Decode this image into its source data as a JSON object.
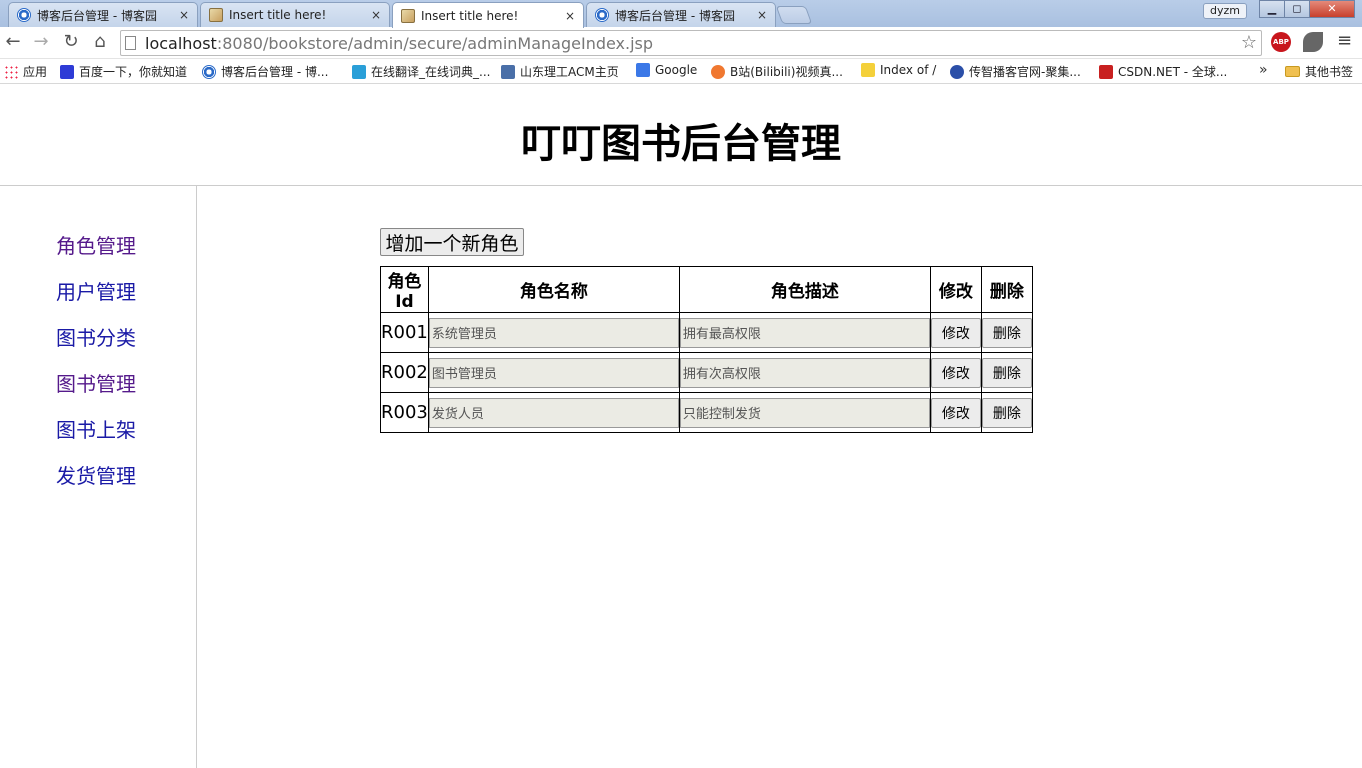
{
  "browser": {
    "tabs": [
      {
        "title": "博客后台管理 - 博客园",
        "icon": "cnblogs-icon",
        "active": false
      },
      {
        "title": "Insert title here!",
        "icon": "image-icon",
        "active": false
      },
      {
        "title": "Insert title here!",
        "icon": "image-icon",
        "active": true
      },
      {
        "title": "博客后台管理 - 博客园",
        "icon": "cnblogs-icon",
        "active": false
      }
    ],
    "tab_close_glyph": "×",
    "user_name": "dyzm",
    "url_host": "localhost",
    "url_rest": ":8080/bookstore/admin/secure/adminManageIndex.jsp",
    "abp_label": "ABP",
    "bookmarks": [
      {
        "label": "应用",
        "icon": "apps-icon"
      },
      {
        "label": "百度一下，你就知道",
        "icon": "baidu-icon"
      },
      {
        "label": "博客后台管理 - 博...",
        "icon": "cnblogs-icon"
      },
      {
        "label": "在线翻译_在线词典_...",
        "icon": "dict-icon"
      },
      {
        "label": "山东理工ACM主页",
        "icon": "acm-icon"
      },
      {
        "label": "Google",
        "icon": "google-icon"
      },
      {
        "label": "B站(Bilibili)视频真...",
        "icon": "bilibili-icon"
      },
      {
        "label": "Index of /",
        "icon": "index-icon"
      },
      {
        "label": "传智播客官网-聚集...",
        "icon": "itcast-icon"
      },
      {
        "label": "CSDN.NET - 全球...",
        "icon": "csdn-icon"
      }
    ],
    "bookmarks_more": "»",
    "other_bookmarks": "其他书签"
  },
  "page": {
    "title": "叮叮图书后台管理",
    "sidebar": [
      {
        "label": "角色管理",
        "visited": true
      },
      {
        "label": "用户管理",
        "visited": false
      },
      {
        "label": "图书分类",
        "visited": false
      },
      {
        "label": "图书管理",
        "visited": true
      },
      {
        "label": "图书上架",
        "visited": false
      },
      {
        "label": "发货管理",
        "visited": false
      }
    ],
    "add_button": "增加一个新角色",
    "table": {
      "headers": [
        "角色Id",
        "角色名称",
        "角色描述",
        "修改",
        "删除"
      ],
      "rows": [
        {
          "id": "R001",
          "name": "系统管理员",
          "desc": "拥有最高权限"
        },
        {
          "id": "R002",
          "name": "图书管理员",
          "desc": "拥有次高权限"
        },
        {
          "id": "R003",
          "name": "发货人员",
          "desc": "只能控制发货"
        }
      ],
      "edit_label": "修改",
      "delete_label": "删除"
    }
  }
}
